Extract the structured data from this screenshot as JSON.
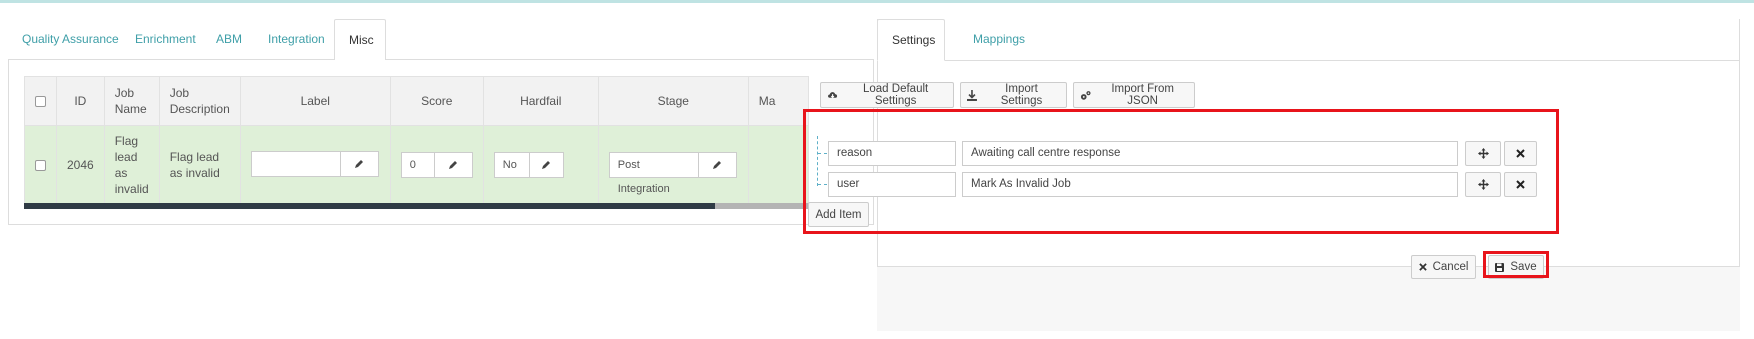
{
  "left_tabs": [
    "Quality Assurance",
    "Enrichment",
    "ABM",
    "Integration",
    "Misc"
  ],
  "table": {
    "headers": {
      "id": "ID",
      "job_name": "Job Name",
      "job_description": "Job Description",
      "label": "Label",
      "score": "Score",
      "hardfail": "Hardfail",
      "stage": "Stage",
      "more": "Ma"
    },
    "row": {
      "id": "2046",
      "job_name": "Flag lead as invalid",
      "job_description": "Flag lead as invalid",
      "label": "",
      "score": "0",
      "hardfail": "No",
      "stage": "Post Integration"
    },
    "scroll_fraction": 0.83
  },
  "right_tabs": [
    "Settings",
    "Mappings"
  ],
  "settings_buttons": {
    "load_default": "Load Default Settings",
    "import_settings": "Import Settings",
    "import_json": "Import From JSON"
  },
  "items": [
    {
      "key": "reason",
      "value": "Awaiting call centre response"
    },
    {
      "key": "user",
      "value": "Mark As Invalid Job"
    }
  ],
  "add_item": "Add Item",
  "footer": {
    "cancel": "Cancel",
    "save": "Save"
  },
  "colors": {
    "highlight": "#e8141b",
    "tab_link": "#3f9fa8",
    "row_bg": "#dff0d8"
  }
}
